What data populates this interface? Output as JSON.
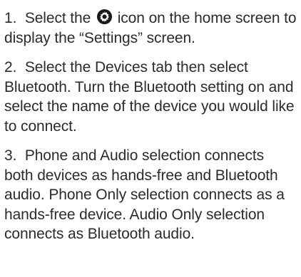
{
  "steps": [
    {
      "number": "1.",
      "before_icon": "Select the",
      "icon": "settings-gear-icon",
      "after_icon": "icon on the home screen to display the “Settings” screen."
    },
    {
      "number": "2.",
      "text": "Select the Devices tab then select Bluetooth. Turn the Bluetooth setting on and select the name of the device you would like to connect."
    },
    {
      "number": "3.",
      "text": "Phone and Audio selection connects both devices as hands-free and Bluetooth audio. Phone Only selection connects as a hands-free device. Audio Only selection connects as Bluetooth audio."
    }
  ],
  "colors": {
    "text": "#2b2b2b",
    "icon": "#1a1a1a"
  }
}
